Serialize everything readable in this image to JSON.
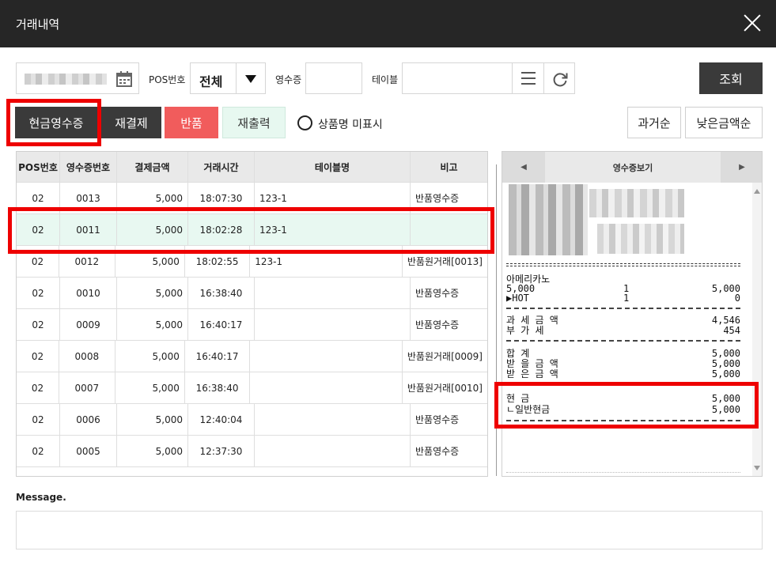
{
  "window": {
    "title": "거래내역"
  },
  "filters": {
    "pos_label": "POS번호",
    "pos_value": "전체",
    "receipt_label": "영수증",
    "table_label": "테이블",
    "search_button": "조회"
  },
  "actions": {
    "cash_receipt": "현금영수증",
    "repay": "재결제",
    "refund": "반품",
    "reprint": "재출력",
    "hide_product_name": "상품명 미표시",
    "sort_oldest": "과거순",
    "sort_lowest_amount": "낮은금액순"
  },
  "table": {
    "headers": [
      "POS번호",
      "영수증번호",
      "결제금액",
      "거래시간",
      "테이블명",
      "비고"
    ],
    "rows": [
      [
        "02",
        "0013",
        "5,000",
        "18:07:30",
        "123-1",
        "반품영수증"
      ],
      [
        "02",
        "0011",
        "5,000",
        "18:02:28",
        "123-1",
        ""
      ],
      [
        "02",
        "0012",
        "5,000",
        "18:02:55",
        "123-1",
        "반품원거래[0013]"
      ],
      [
        "02",
        "0010",
        "5,000",
        "16:38:40",
        "",
        "반품영수증"
      ],
      [
        "02",
        "0009",
        "5,000",
        "16:40:17",
        "",
        "반품영수증"
      ],
      [
        "02",
        "0008",
        "5,000",
        "16:40:17",
        "",
        "반품원거래[0009]"
      ],
      [
        "02",
        "0007",
        "5,000",
        "16:38:40",
        "",
        "반품원거래[0010]"
      ],
      [
        "02",
        "0006",
        "5,000",
        "12:40:04",
        "",
        "반품영수증"
      ],
      [
        "02",
        "0005",
        "5,000",
        "12:37:30",
        "",
        "반품영수증"
      ]
    ],
    "selected_row": 1
  },
  "receipt": {
    "title": "영수증보기",
    "item_name": "아메리카노",
    "item_line": {
      "price": "5,000",
      "qty": "1",
      "amount": "5,000"
    },
    "option_line": {
      "name": "▶HOT",
      "qty": "1",
      "amount": "0"
    },
    "tax": [
      {
        "label": "과 세 금 액",
        "value": "4,546"
      },
      {
        "label": "부   가   세",
        "value": "454"
      }
    ],
    "totals": [
      {
        "label": "합        계",
        "value": "5,000"
      },
      {
        "label": "받 을  금 액",
        "value": "5,000"
      },
      {
        "label": "받 은  금 액",
        "value": "5,000"
      }
    ],
    "payment": [
      {
        "label": "현         금",
        "value": "5,000"
      },
      {
        "label": "ㄴ일반현금",
        "value": "5,000"
      }
    ]
  },
  "message": {
    "label": "Message."
  },
  "colors": {
    "highlight": "#ee0000",
    "refund": "#f15c5c",
    "selected_row": "#e8f8f1",
    "titlebar": "#262626"
  }
}
